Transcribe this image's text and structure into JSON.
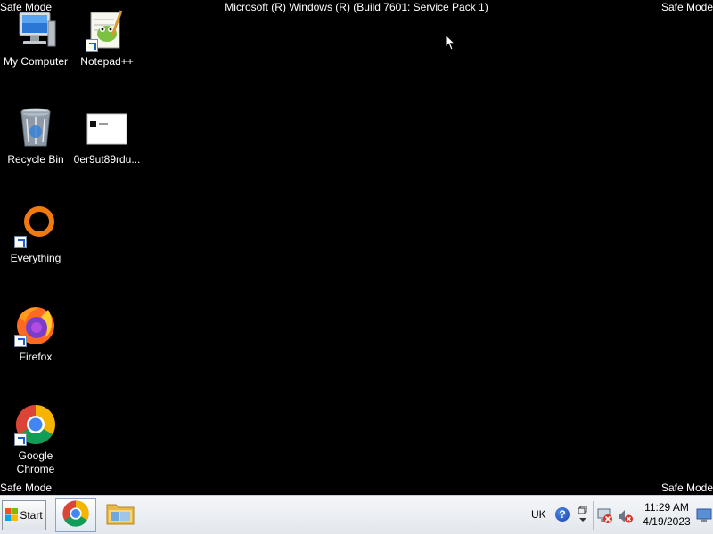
{
  "overlay": {
    "safe_mode": "Safe Mode",
    "build": "Microsoft (R) Windows (R) (Build 7601: Service Pack 1)"
  },
  "desktop_icons": [
    {
      "label": "My Computer",
      "icon": "computer-icon"
    },
    {
      "label": "Notepad++",
      "icon": "notepad-plus-plus-icon"
    },
    {
      "label": "Recycle Bin",
      "icon": "recycle-bin-icon"
    },
    {
      "label": "0er9ut89rdu...",
      "icon": "image-file-icon"
    },
    {
      "label": "Everything",
      "icon": "everything-search-icon"
    },
    {
      "label": "Firefox",
      "icon": "firefox-icon"
    },
    {
      "label": "Google Chrome",
      "icon": "chrome-icon"
    }
  ],
  "taskbar": {
    "start_label": "Start",
    "apps": [
      {
        "name": "Google Chrome",
        "icon": "chrome-icon"
      },
      {
        "name": "Windows Explorer",
        "icon": "folder-icon"
      }
    ],
    "tray": {
      "language": "UK",
      "time": "11:29 AM",
      "date": "4/19/2023"
    }
  },
  "colors": {
    "desktop_background": "#000000",
    "taskbar_background": "#e9ecf1"
  }
}
